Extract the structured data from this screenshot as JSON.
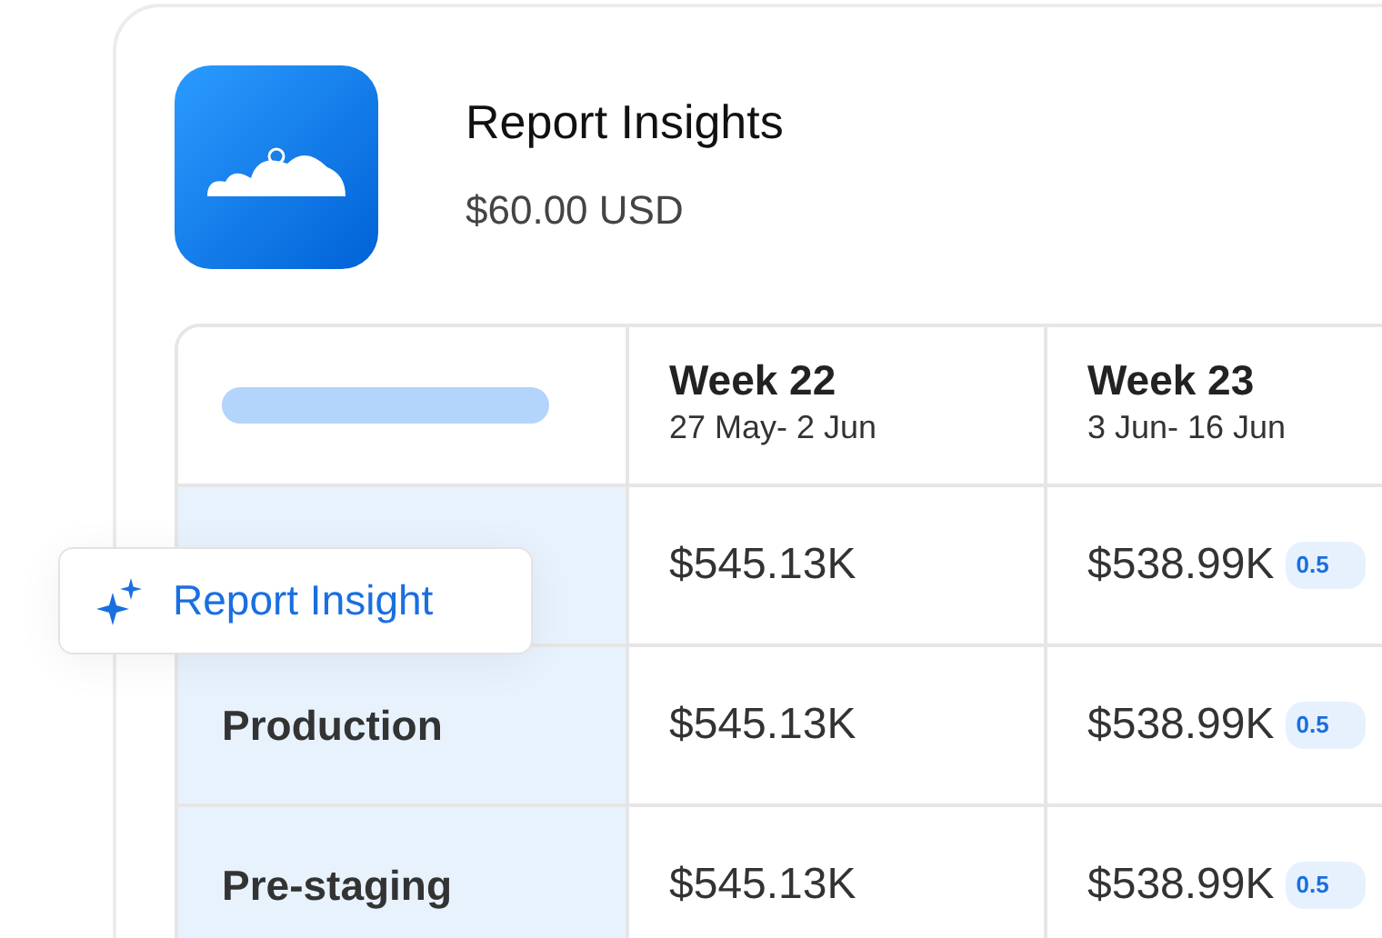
{
  "product": {
    "title": "Report Insights",
    "price": "$60.00 USD"
  },
  "table": {
    "columns": [
      {
        "title": "Week 22",
        "dates": "27 May- 2 Jun"
      },
      {
        "title": "Week 23",
        "dates": "3 Jun- 16 Jun"
      }
    ],
    "rows": [
      {
        "cells": [
          {
            "value": "$545.13K"
          },
          {
            "value": "$538.99K",
            "change": "0.5"
          }
        ]
      },
      {
        "label": "Production",
        "cells": [
          {
            "value": "$545.13K"
          },
          {
            "value": "$538.99K",
            "change": "0.5"
          }
        ]
      },
      {
        "label": "Pre-staging",
        "cells": [
          {
            "value": "$545.13K"
          },
          {
            "value": "$538.99K",
            "change": "0.5"
          }
        ]
      }
    ]
  },
  "insight_button": {
    "label": "Report Insight"
  }
}
